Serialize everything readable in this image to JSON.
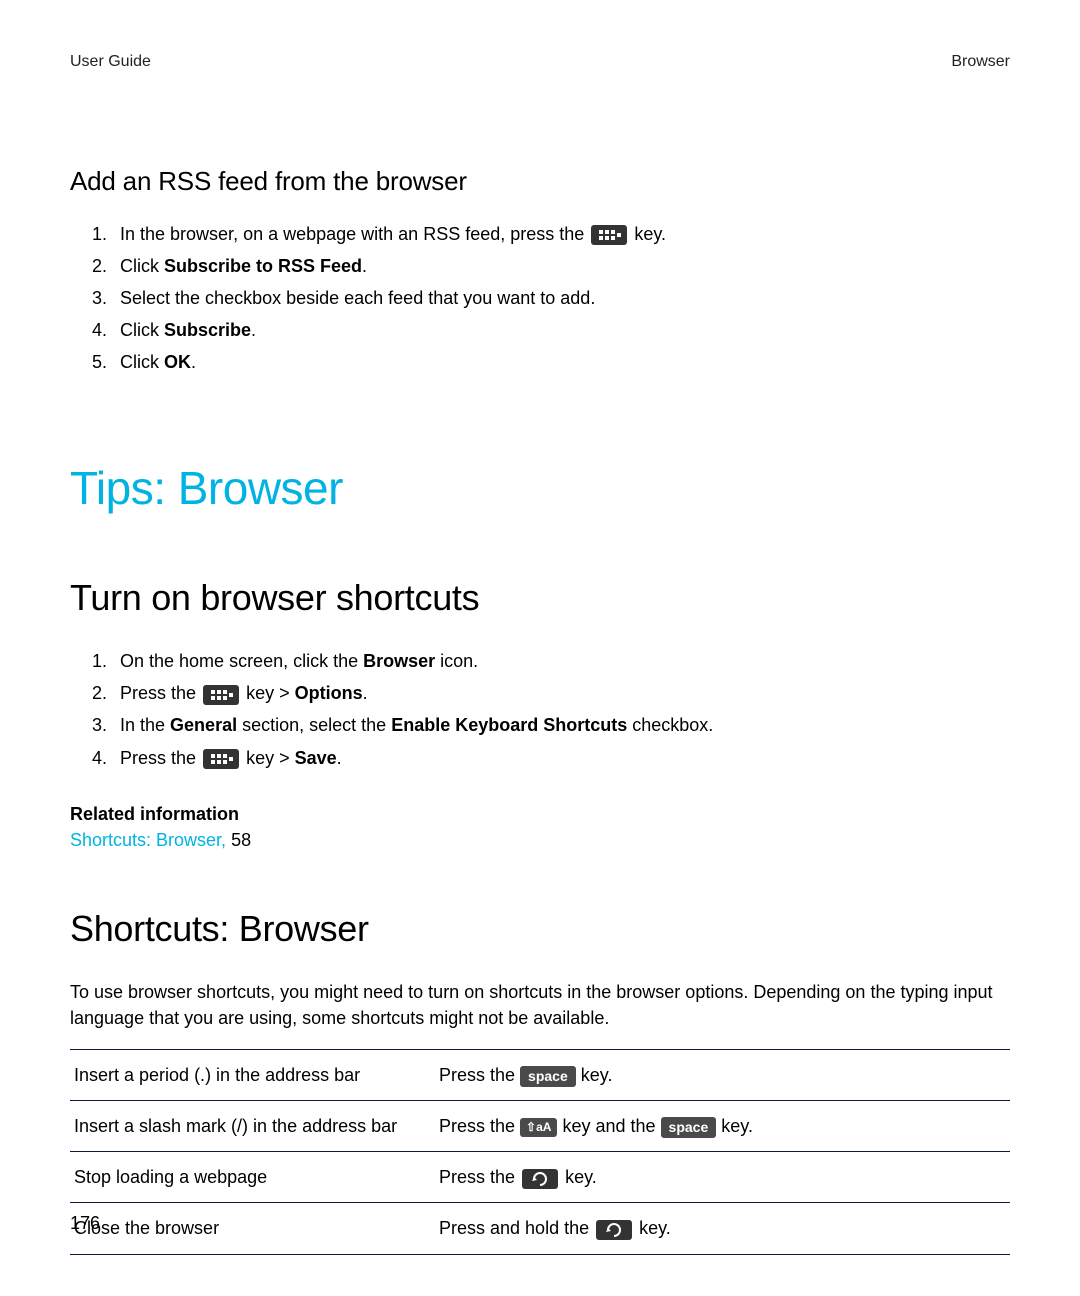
{
  "header": {
    "left": "User Guide",
    "right": "Browser"
  },
  "rss": {
    "heading": "Add an RSS feed from the browser",
    "step1_a": "In the browser, on a webpage with an RSS feed, press the ",
    "step1_b": " key.",
    "step2_a": "Click ",
    "step2_b": "Subscribe to RSS Feed",
    "step2_c": ".",
    "step3": "Select the checkbox beside each feed that you want to add.",
    "step4_a": "Click ",
    "step4_b": "Subscribe",
    "step4_c": ".",
    "step5_a": "Click ",
    "step5_b": "OK",
    "step5_c": "."
  },
  "tips_heading": "Tips: Browser",
  "turn_on": {
    "heading": "Turn on browser shortcuts",
    "step1_a": "On the home screen, click the ",
    "step1_b": "Browser",
    "step1_c": " icon.",
    "step2_a": "Press the ",
    "step2_b": " key > ",
    "step2_c": "Options",
    "step2_d": ".",
    "step3_a": "In the ",
    "step3_b": "General",
    "step3_c": " section, select the ",
    "step3_d": "Enable Keyboard Shortcuts",
    "step3_e": " checkbox.",
    "step4_a": "Press the ",
    "step4_b": " key > ",
    "step4_c": "Save",
    "step4_d": "."
  },
  "related": {
    "label": "Related information",
    "link_text": "Shortcuts: Browser, ",
    "link_page": "58"
  },
  "shortcuts": {
    "heading": "Shortcuts: Browser",
    "intro": "To use browser shortcuts, you might need to turn on shortcuts in the browser options. Depending on the typing input language that you are using, some shortcuts might not be available.",
    "rows": {
      "r1": {
        "left": "Insert a period (.) in the address bar",
        "a": "Press the ",
        "key1": "space",
        "b": " key."
      },
      "r2": {
        "left": "Insert a slash mark (/) in the address bar",
        "a": "Press the ",
        "shift": "⇧aA",
        "b": " key and the ",
        "key2": "space",
        "c": " key."
      },
      "r3": {
        "left": "Stop loading a webpage",
        "a": "Press the ",
        "b": " key."
      },
      "r4": {
        "left": "Close the browser",
        "a": "Press and hold the ",
        "b": " key."
      }
    }
  },
  "page_number": "176"
}
